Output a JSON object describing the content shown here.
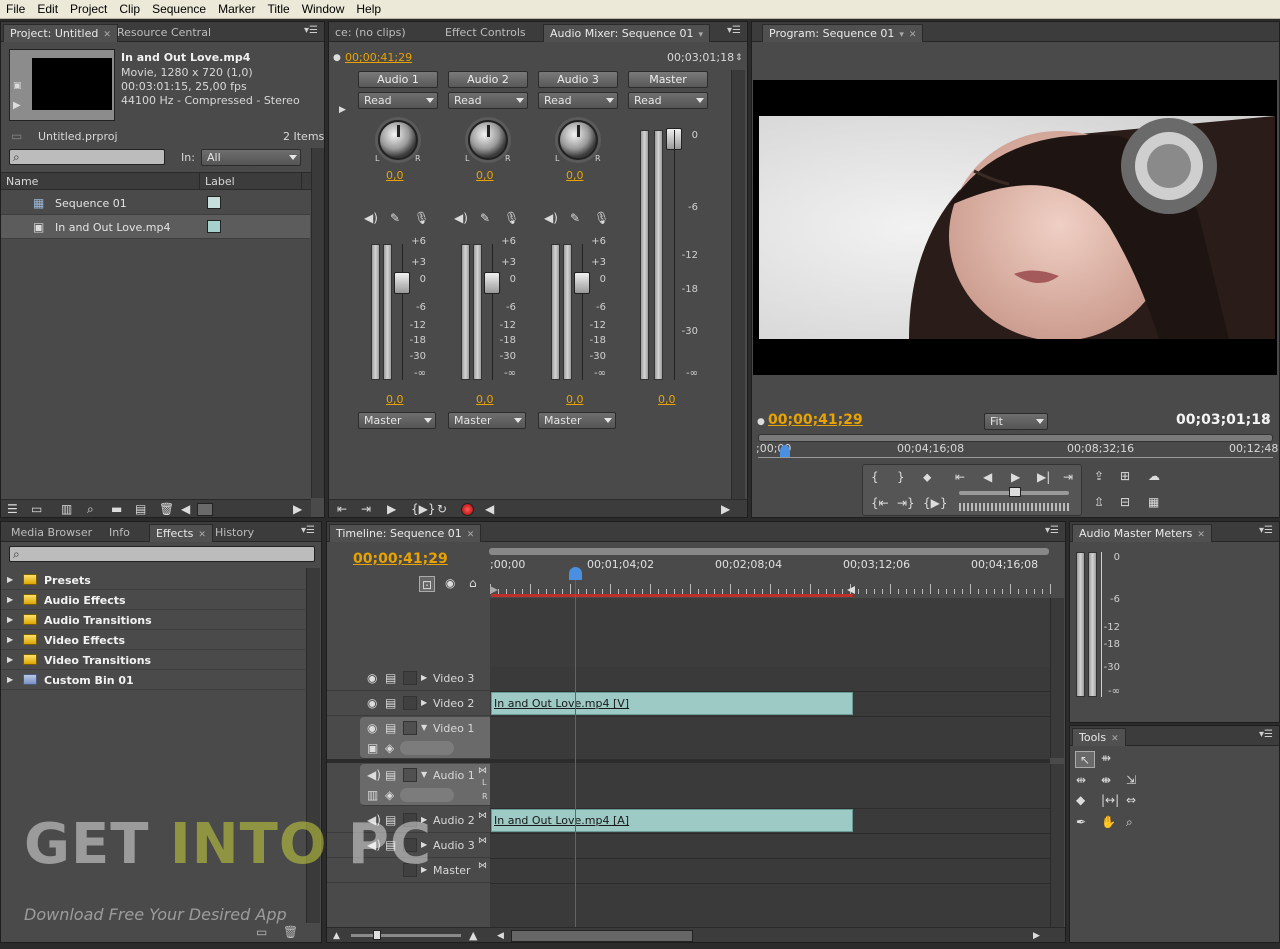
{
  "menu": [
    "File",
    "Edit",
    "Project",
    "Clip",
    "Sequence",
    "Marker",
    "Title",
    "Window",
    "Help"
  ],
  "project": {
    "tab_project": "Project: Untitled",
    "tab_resource": "Resource Central",
    "clip_name": "In and Out Love.mp4",
    "clip_info1": "Movie, 1280 x 720 (1,0)",
    "clip_info2": "00:03:01:15, 25,00 fps",
    "clip_info3": "44100 Hz - Compressed - Stereo",
    "project_file": "Untitled.prproj",
    "items_count": "2 Items",
    "in_label": "In:",
    "in_value": "All",
    "col_name": "Name",
    "col_label": "Label",
    "items": [
      {
        "name": "Sequence 01",
        "label_color": "#c8dedc"
      },
      {
        "name": "In and Out Love.mp4",
        "label_color": "#a6d0cb"
      }
    ]
  },
  "mixer": {
    "tab_source": "ce: (no clips)",
    "tab_effect_controls": "Effect Controls",
    "tab_audio_mixer": "Audio Mixer: Sequence 01",
    "timecode_left": "00;00;41;29",
    "timecode_right": "00;03;01;18",
    "channels": [
      {
        "name": "Audio 1",
        "mode": "Read",
        "pan": "0,0",
        "level": "0,0",
        "output": "Master"
      },
      {
        "name": "Audio 2",
        "mode": "Read",
        "pan": "0,0",
        "level": "0,0",
        "output": "Master"
      },
      {
        "name": "Audio 3",
        "mode": "Read",
        "pan": "0,0",
        "level": "0,0",
        "output": "Master"
      }
    ],
    "master": {
      "name": "Master",
      "mode": "Read",
      "level": "0,0"
    },
    "scale": [
      "+6",
      "+3",
      "0",
      "-6",
      "-12",
      "-18",
      "-30",
      "-∞"
    ],
    "master_scale": [
      "0",
      "-6",
      "-12",
      "-18",
      "-30",
      "-∞"
    ],
    "pan_l": "L",
    "pan_r": "R"
  },
  "program": {
    "tab": "Program: Sequence 01",
    "timecode": "00;00;41;29",
    "fit": "Fit",
    "duration": "00;03;01;18",
    "ruler": [
      ";00;00",
      "00;04;16;08",
      "00;08;32;16",
      "00;12;48"
    ]
  },
  "effects": {
    "tabs": [
      "Media Browser",
      "Info",
      "Effects",
      "History"
    ],
    "items": [
      "Presets",
      "Audio Effects",
      "Audio Transitions",
      "Video Effects",
      "Video Transitions",
      "Custom Bin 01"
    ]
  },
  "timeline": {
    "tab": "Timeline: Sequence 01",
    "timecode": "00;00;41;29",
    "ruler": ";00;00|00;01;04;02|00;02;08;04|00;03;12;06|00;04;16;08",
    "video_tracks": [
      "Video 3",
      "Video 2",
      "Video 1"
    ],
    "audio_tracks": [
      "Audio 1",
      "Audio 2",
      "Audio 3",
      "Master"
    ],
    "video_clip": "In and Out Love.mp4 [V]",
    "audio_clip": "In and Out Love.mp4 [A]",
    "audio_lr_l": "L",
    "audio_lr_r": "R"
  },
  "meters": {
    "tab": "Audio Master Meters",
    "scale": [
      "0",
      "-6",
      "-12",
      "-18",
      "-30",
      "-∞"
    ]
  },
  "tools": {
    "tab": "Tools"
  },
  "watermark": {
    "line1a": "GET ",
    "line1b": "INTO",
    "line1c": " PC",
    "line2": "Download Free Your Desired App"
  }
}
